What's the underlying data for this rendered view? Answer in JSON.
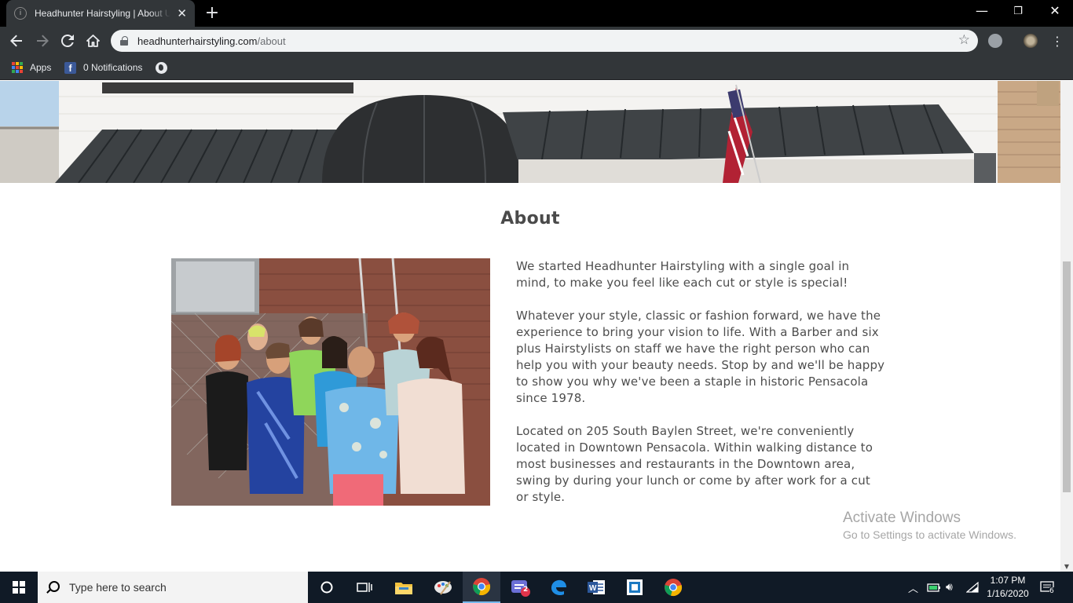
{
  "browser": {
    "tab_title": "Headhunter Hairstyling | About Us",
    "url_host": "headhunterhairstyling.com",
    "url_path": "/about",
    "bookmarks": {
      "apps_label": "Apps",
      "notifications_label": "0 Notifications"
    }
  },
  "page": {
    "heading": "About",
    "paragraphs": [
      "We started Headhunter Hairstyling with a single goal in mind, to make you feel like each cut or style is special!",
      "Whatever your style, classic or fashion forward, we have the experience to bring your vision to life. With a Barber and six plus Hairstylists on staff we have the right person who can help you with your beauty needs. Stop by and we'll be happy to show you why we've been a staple in historic Pensacola since 1978.",
      "Located on 205 South Baylen Street, we're conveniently located in Downtown Pensacola. Within walking distance to most businesses and restaurants in the Downtown area, swing by during your lunch or come by after work for a cut or style."
    ]
  },
  "watermark": {
    "title": "Activate Windows",
    "subtitle": "Go to Settings to activate Windows."
  },
  "taskbar": {
    "search_placeholder": "Type here to search",
    "time": "1:07 PM",
    "date": "1/16/2020",
    "notification_count": "6",
    "mail_badge": "2",
    "pinned_icons": [
      "cortana-icon",
      "task-view-icon",
      "file-explorer-icon",
      "paint-icon",
      "chrome-icon",
      "app-icon",
      "edge-icon",
      "word-icon",
      "app-icon",
      "chrome-icon"
    ]
  },
  "colors": {
    "text": "#4d4d4d",
    "heading": "#4a4a4a",
    "taskbar": "#101a26",
    "chrome_toolbar": "#323639"
  }
}
